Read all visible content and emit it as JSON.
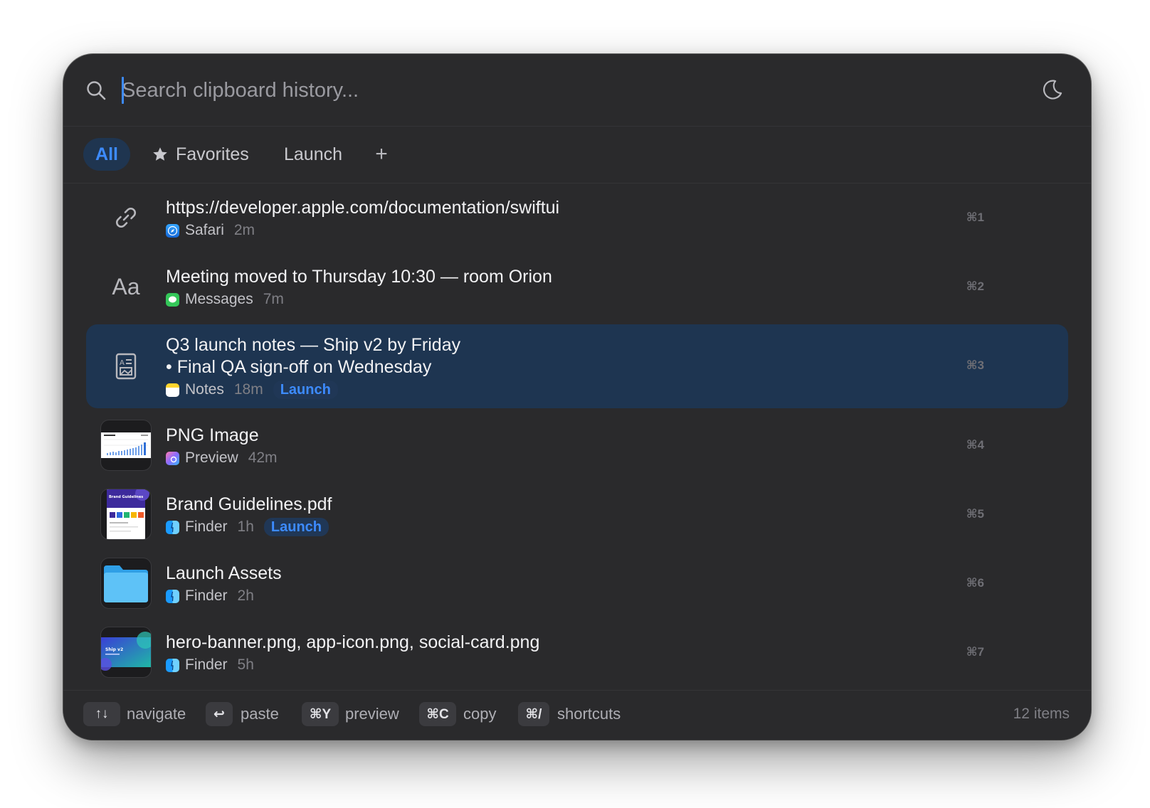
{
  "search": {
    "placeholder": "Search clipboard history...",
    "value": ""
  },
  "tabs": [
    {
      "label": "All",
      "active": true
    },
    {
      "label": "Favorites",
      "icon": "star-icon"
    },
    {
      "label": "Launch"
    },
    {
      "label": "+",
      "icon": "plus-icon"
    }
  ],
  "items": [
    {
      "kind": "link",
      "icon": "link-icon",
      "title": "https://developer.apple.com/documentation/swiftui",
      "app": "Safari",
      "time": "2m",
      "shortcut": "⌘1"
    },
    {
      "kind": "text",
      "icon": "text-icon",
      "title": "Meeting moved to Thursday 10:30 — room Orion",
      "app": "Messages",
      "time": "7m",
      "shortcut": "⌘2"
    },
    {
      "kind": "rich-text",
      "icon": "rich-text-icon",
      "title": "Q3 launch notes — Ship v2 by Friday",
      "title_line2": "• Final QA sign-off on Wednesday",
      "app": "Notes",
      "time": "18m",
      "tag": "Launch",
      "shortcut": "⌘3",
      "selected": true
    },
    {
      "kind": "image",
      "icon": "image-thumbnail",
      "title": "PNG Image",
      "app": "Preview",
      "time": "42m",
      "shortcut": "⌘4"
    },
    {
      "kind": "pdf",
      "icon": "pdf-thumbnail",
      "title": "Brand Guidelines.pdf",
      "app": "Finder",
      "time": "1h",
      "tag": "Launch",
      "shortcut": "⌘5",
      "thumb_text": "Brand Guidelines"
    },
    {
      "kind": "folder",
      "icon": "folder-icon",
      "title": "Launch Assets",
      "app": "Finder",
      "time": "2h",
      "shortcut": "⌘6"
    },
    {
      "kind": "files",
      "icon": "files-thumbnail",
      "title": "hero-banner.png, app-icon.png, social-card.png",
      "app": "Finder",
      "time": "5h",
      "shortcut": "⌘7",
      "thumb_text": "Ship v2"
    }
  ],
  "footer": {
    "hints": [
      {
        "key": "↑↓",
        "label": "navigate"
      },
      {
        "key": "↩",
        "label": "paste"
      },
      {
        "key": "⌘Y",
        "label": "preview"
      },
      {
        "key": "⌘C",
        "label": "copy"
      },
      {
        "key": "⌘/",
        "label": "shortcuts"
      }
    ],
    "count": "12 items"
  },
  "colors": {
    "window_bg": "#2a2a2c",
    "accent": "#3d8bff",
    "selected_row": "#1e3551"
  }
}
